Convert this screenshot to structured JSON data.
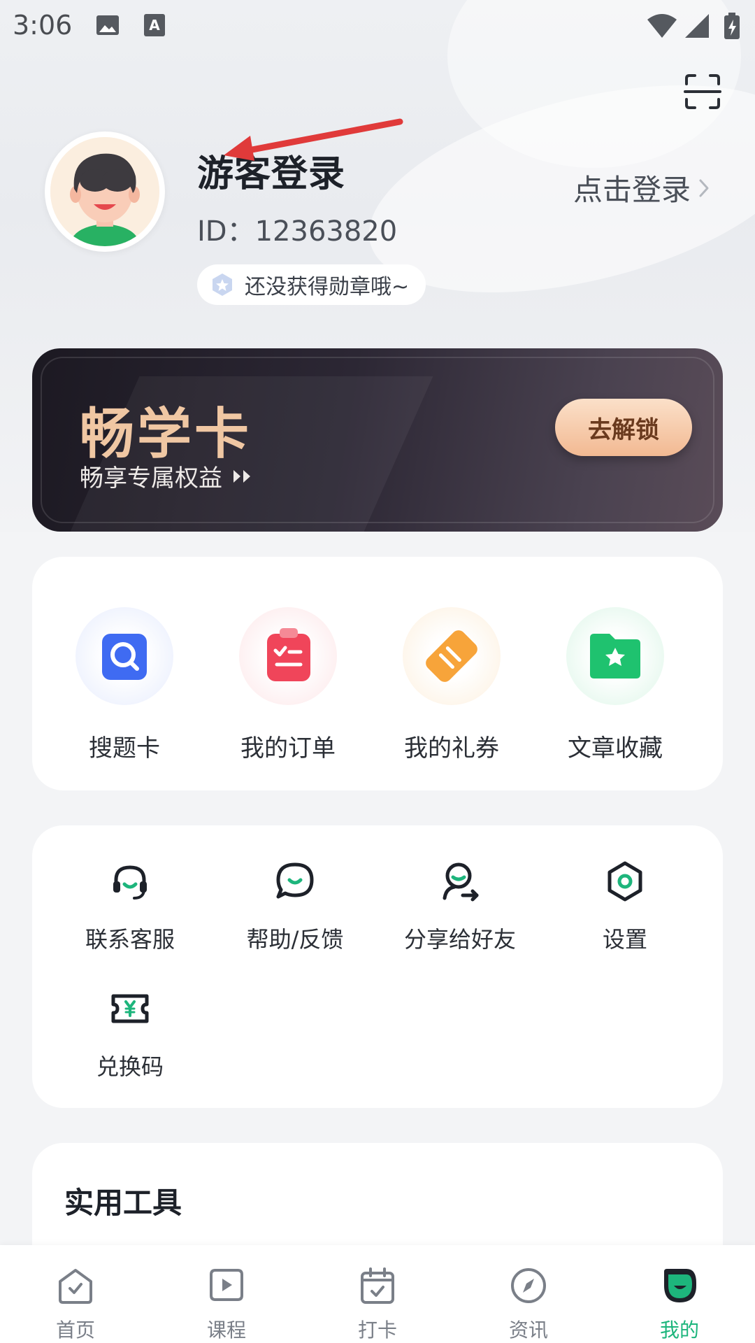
{
  "status_bar": {
    "time": "3:06"
  },
  "profile": {
    "name": "游客登录",
    "id_text": "ID：12363820",
    "login_link": "点击登录",
    "badge_text": "还没获得勋章哦~"
  },
  "vip_card": {
    "title": "畅学卡",
    "subtitle": "畅享专属权益",
    "button": "去解锁"
  },
  "quick_actions": [
    {
      "label": "搜题卡",
      "icon": "search-card-icon",
      "color": "#3f6bf2"
    },
    {
      "label": "我的订单",
      "icon": "order-icon",
      "color": "#f0455a"
    },
    {
      "label": "我的礼券",
      "icon": "coupon-icon",
      "color": "#f7a43a"
    },
    {
      "label": "文章收藏",
      "icon": "folder-star-icon",
      "color": "#1fc26f"
    }
  ],
  "services": [
    {
      "label": "联系客服",
      "icon": "headset-icon"
    },
    {
      "label": "帮助/反馈",
      "icon": "chat-bubble-icon"
    },
    {
      "label": "分享给好友",
      "icon": "share-user-icon"
    },
    {
      "label": "设置",
      "icon": "hexagon-settings-icon"
    },
    {
      "label": "兑换码",
      "icon": "ticket-yen-icon"
    }
  ],
  "tools": {
    "title": "实用工具"
  },
  "tab_bar": [
    {
      "label": "首页",
      "icon": "home-icon"
    },
    {
      "label": "课程",
      "icon": "play-icon"
    },
    {
      "label": "打卡",
      "icon": "calendar-check-icon"
    },
    {
      "label": "资讯",
      "icon": "compass-icon"
    },
    {
      "label": "我的",
      "icon": "profile-face-icon",
      "active": true
    }
  ],
  "colors": {
    "accent": "#1db57c",
    "annotation_arrow": "#e03a3a"
  }
}
